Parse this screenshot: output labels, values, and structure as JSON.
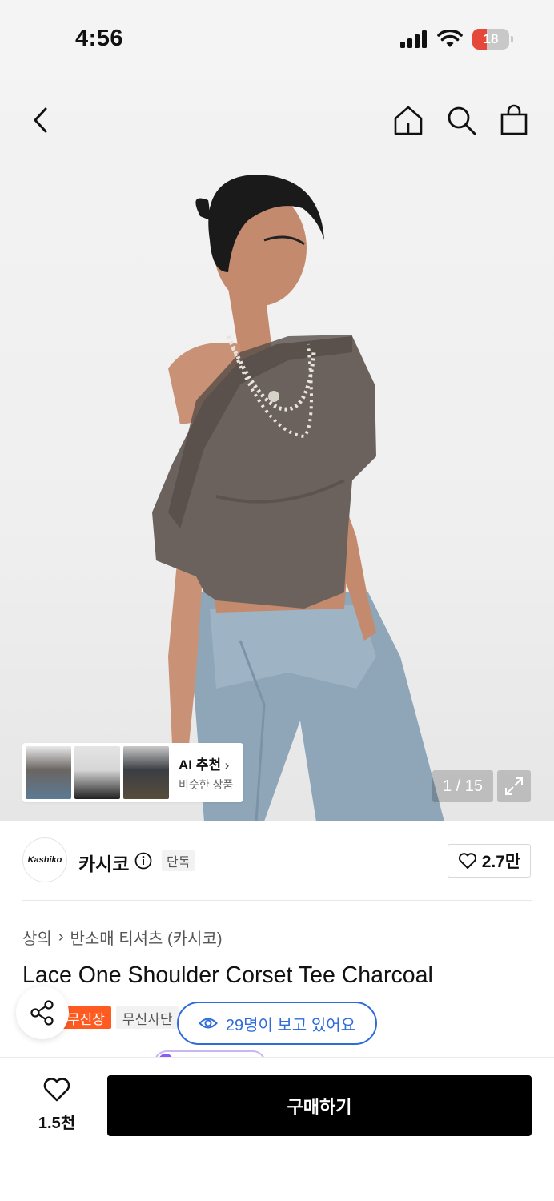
{
  "status_bar": {
    "time": "4:56",
    "battery_level": "18",
    "battery_color": "#e5483b",
    "icons": [
      "signal-icon",
      "wifi-icon",
      "battery-icon"
    ]
  },
  "nav": {
    "icons": [
      "back-icon",
      "home-icon",
      "search-icon",
      "shopping-bag-icon"
    ]
  },
  "gallery": {
    "ai_title": "AI 추천",
    "ai_subtitle": "비슷한 상품",
    "counter": "1 / 15"
  },
  "brand": {
    "logo_text": "Kashiko",
    "name": "카시코",
    "exclusive_badge": "단독",
    "like_count": "2.7만"
  },
  "breadcrumb": {
    "category": "상의",
    "subcategory": "반소매 티셔츠 (카시코)"
  },
  "product": {
    "title": "Lace One Shoulder Corset Tee Charcoal",
    "tags": [
      "무진장",
      "무신사단"
    ],
    "viewers": "29명이 보고 있어요"
  },
  "bottom_bar": {
    "wish_count": "1.5천",
    "buy_label": "구매하기"
  },
  "colors": {
    "accent_orange": "#ff5a1f",
    "viewer_blue": "#2f6bd9",
    "buy_button": "#000000"
  }
}
